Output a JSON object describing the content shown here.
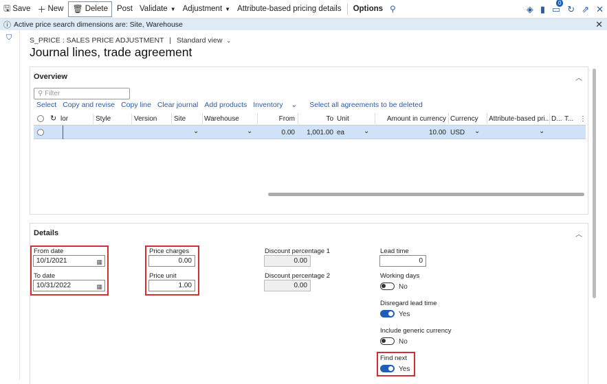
{
  "toolbar": {
    "save": "Save",
    "new": "New",
    "delete": "Delete",
    "post": "Post",
    "validate": "Validate",
    "adjustment": "Adjustment",
    "attribute_pricing": "Attribute-based pricing details",
    "options": "Options",
    "notification_count": "0"
  },
  "infobar": {
    "message": "Active price search dimensions are: Site, Warehouse"
  },
  "breadcrumb": {
    "path": "S_PRICE : SALES PRICE ADJUSTMENT",
    "divider": "|",
    "view": "Standard view"
  },
  "page_title": "Journal lines, trade agreement",
  "overview": {
    "header": "Overview",
    "filter_placeholder": "Filter",
    "actions": [
      "Select",
      "Copy and revise",
      "Copy line",
      "Clear journal",
      "Add products",
      "Inventory",
      "Select all agreements to be deleted"
    ],
    "columns": {
      "color": "lor",
      "style": "Style",
      "version": "Version",
      "site": "Site",
      "warehouse": "Warehouse",
      "from": "From",
      "to": "To",
      "unit": "Unit",
      "amount": "Amount in currency",
      "currency": "Currency",
      "attribute": "Attribute-based pri...",
      "d": "D...",
      "t": "T..."
    },
    "row": {
      "from": "0.00",
      "to": "1,001.00",
      "unit": "ea",
      "amount": "10.00",
      "currency": "USD"
    }
  },
  "details": {
    "header": "Details",
    "from_date_label": "From date",
    "from_date": "10/1/2021",
    "to_date_label": "To date",
    "to_date": "10/31/2022",
    "price_charges_label": "Price charges",
    "price_charges": "0.00",
    "price_unit_label": "Price unit",
    "price_unit": "1.00",
    "discount1_label": "Discount percentage 1",
    "discount1": "0.00",
    "discount2_label": "Discount percentage 2",
    "discount2": "0.00",
    "lead_time_label": "Lead time",
    "lead_time": "0",
    "working_days_label": "Working days",
    "working_days": "No",
    "disregard_label": "Disregard lead time",
    "disregard": "Yes",
    "generic_currency_label": "Include generic currency",
    "generic_currency": "No",
    "find_next_label": "Find next",
    "find_next": "Yes"
  }
}
